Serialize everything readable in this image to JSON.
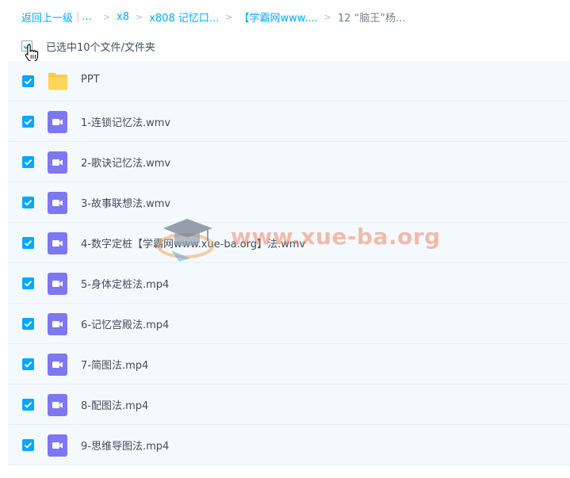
{
  "breadcrumb": {
    "back": "返回上一级",
    "separator": "|",
    "ellipsis": "...",
    "items": [
      "x8",
      "x808 记忆口...",
      "【学霸网www....",
      "12 “脑王”杨..."
    ],
    "arrow": ">"
  },
  "selection": {
    "text": "已选中10个文件/文件夹"
  },
  "files": [
    {
      "name": "PPT",
      "type": "folder",
      "checked": true
    },
    {
      "name": "1-连锁记忆法.wmv",
      "type": "video",
      "checked": true
    },
    {
      "name": "2-歌诀记忆法.wmv",
      "type": "video",
      "checked": true
    },
    {
      "name": "3-故事联想法.wmv",
      "type": "video",
      "checked": true
    },
    {
      "name": "4-数字定桩【学霸网www.xue-ba.org】法.wmv",
      "type": "video",
      "checked": true
    },
    {
      "name": "5-身体定桩法.mp4",
      "type": "video",
      "checked": true
    },
    {
      "name": "6-记忆宫殿法.mp4",
      "type": "video",
      "checked": true
    },
    {
      "name": "7-简图法.mp4",
      "type": "video",
      "checked": true
    },
    {
      "name": "8-配图法.mp4",
      "type": "video",
      "checked": true
    },
    {
      "name": "9-思维导图法.mp4",
      "type": "video",
      "checked": true
    }
  ],
  "watermark": {
    "text": "www.xue-ba.org"
  },
  "colors": {
    "accent": "#06a7ff",
    "row_bg": "#f4f9fe",
    "video_icon": "#7e77f2",
    "folder_icon": "#ffc94a"
  }
}
